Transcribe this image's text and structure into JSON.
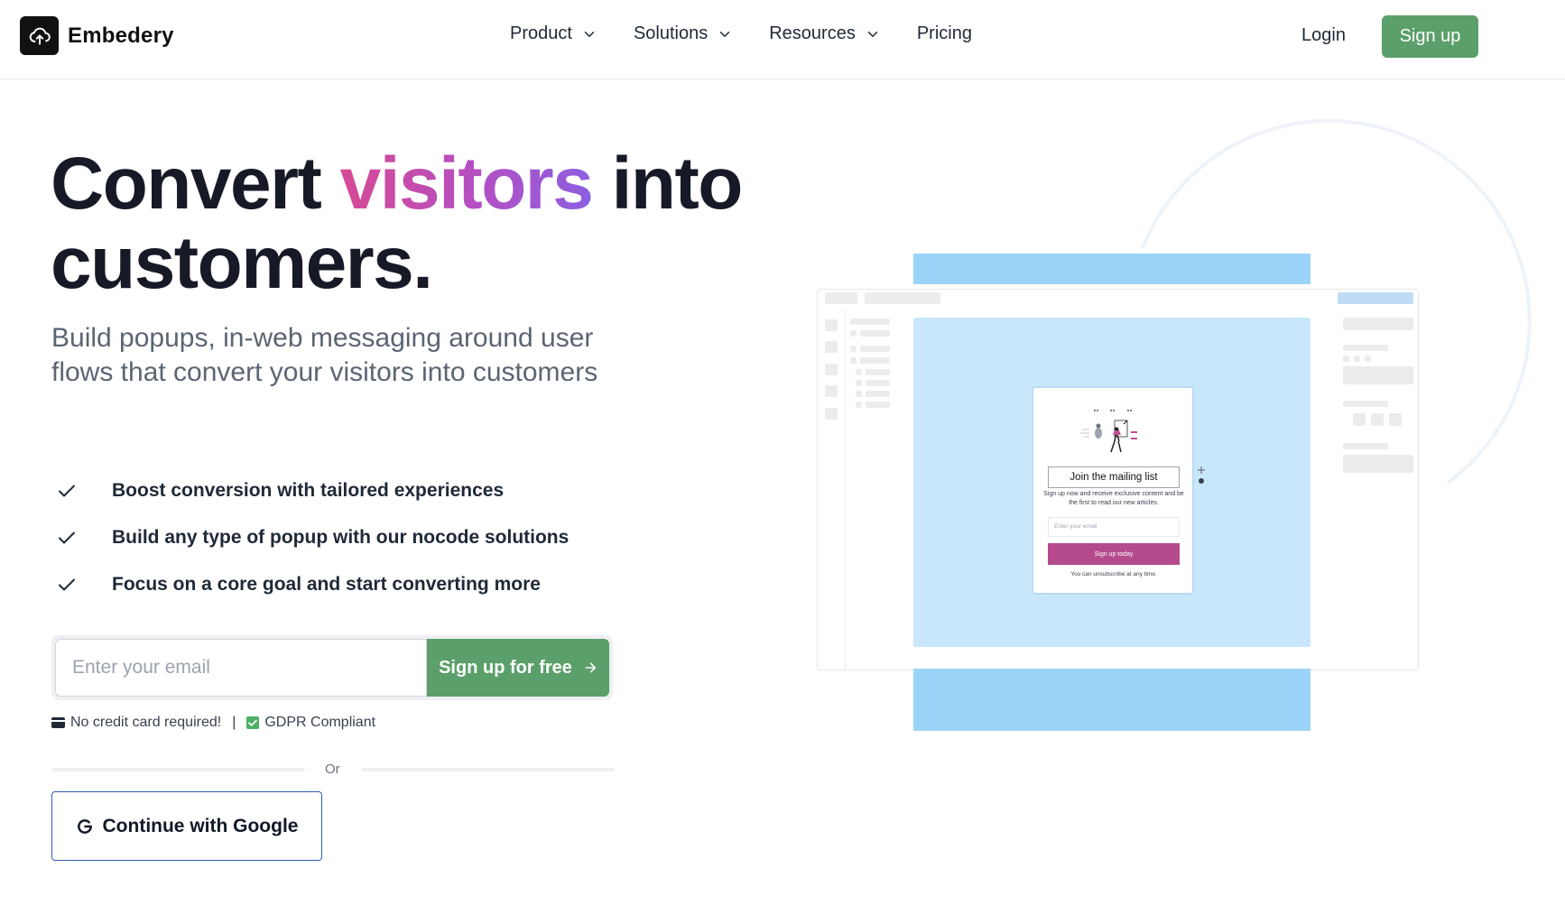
{
  "brand": {
    "name": "Embedery"
  },
  "nav": {
    "items": [
      {
        "label": "Product",
        "has_dropdown": true
      },
      {
        "label": "Solutions",
        "has_dropdown": true
      },
      {
        "label": "Resources",
        "has_dropdown": true
      },
      {
        "label": "Pricing",
        "has_dropdown": false
      }
    ],
    "login_label": "Login",
    "signup_label": "Sign up"
  },
  "hero": {
    "headline_part1": "Convert ",
    "headline_highlight": "visitors",
    "headline_part2": " into customers.",
    "subheadline": "Build popups, in-web messaging around user flows that convert your visitors into customers",
    "features": [
      "Boost conversion with tailored experiences",
      "Build any type of popup with our nocode solutions",
      "Focus on a core goal and start converting more"
    ]
  },
  "signup_form": {
    "email_placeholder": "Enter your email",
    "cta_label": "Sign up for free"
  },
  "trust": {
    "no_card": "No credit card required!",
    "separator": "|",
    "gdpr": "GDPR Compliant"
  },
  "divider_text": "Or",
  "google_button_label": "Continue with Google",
  "illustration": {
    "popup_title": "Join the mailing list",
    "popup_description": "Sign up now and receive exclusive content and be the first to read our new articles.",
    "popup_email_placeholder": "Enter your email",
    "popup_button": "Sign up today",
    "popup_footer": "You can unsubscribe at any time."
  },
  "colors": {
    "accent_green": "#5b9f6a",
    "headline_dark": "#171a26",
    "gradient_start": "#d64a94",
    "gradient_end": "#8b5fe0",
    "popup_button": "#b54a8c",
    "illustration_blue": "#9bd4f8",
    "google_border": "#2f5fb3"
  },
  "icons": {
    "logo": "cloud-upload-icon",
    "dropdown": "chevron-down-icon",
    "feature": "check-icon",
    "cta": "arrow-right-icon",
    "card": "credit-card-icon",
    "gdpr": "checkbox-checked-icon",
    "google": "google-g-icon"
  }
}
